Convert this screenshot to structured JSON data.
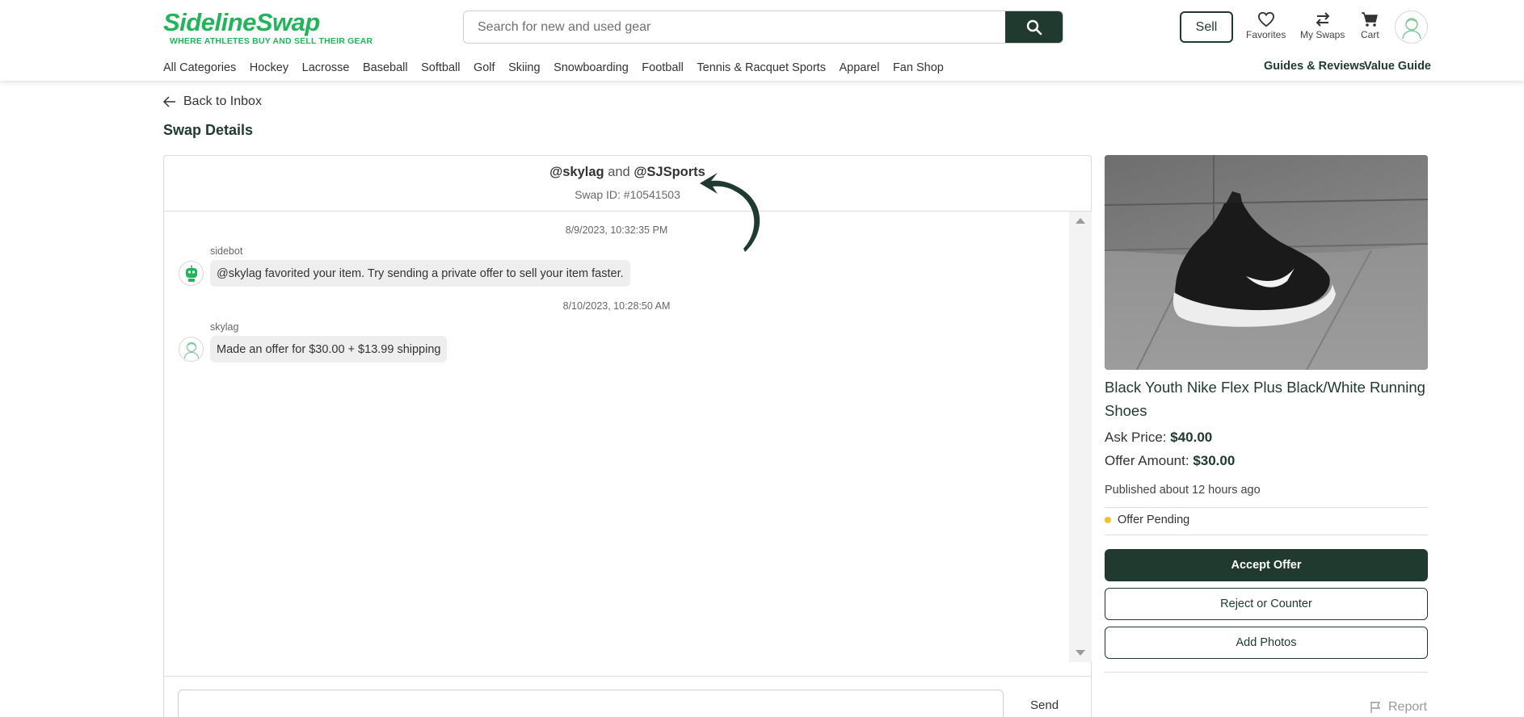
{
  "brand": {
    "logo_text": "SidelineSwap",
    "tagline": "WHERE ATHLETES BUY AND SELL THEIR GEAR",
    "accent": "#22b45a",
    "dark": "#213a30"
  },
  "header": {
    "search_placeholder": "Search for new and used gear",
    "sell_label": "Sell",
    "favorites_label": "Favorites",
    "swaps_label": "My Swaps",
    "cart_label": "Cart"
  },
  "nav": {
    "items": [
      "All Categories",
      "Hockey",
      "Lacrosse",
      "Baseball",
      "Softball",
      "Golf",
      "Skiing",
      "Snowboarding",
      "Football",
      "Tennis & Racquet Sports",
      "Apparel",
      "Fan Shop"
    ],
    "guides_label": "Guides & Reviews",
    "value_guide_label": "Value Guide"
  },
  "page": {
    "back_label": "Back to Inbox",
    "title": "Swap Details"
  },
  "chat": {
    "buyer": "@skylag",
    "and_text": "and",
    "seller": "@SJSports",
    "swap_id": "Swap ID: #10541503",
    "messages": [
      {
        "timestamp": "8/9/2023, 10:32:35 PM",
        "sender": "sidebot",
        "text": "@skylag favorited your item. Try sending a private offer to sell your item faster."
      },
      {
        "timestamp": "8/10/2023, 10:28:50 AM",
        "sender": "skylag",
        "text": "Made an offer for $30.00 + $13.99 shipping"
      }
    ],
    "send_label": "Send"
  },
  "product": {
    "title": "Black Youth Nike Flex Plus Black/White Running Shoes",
    "ask_label": "Ask Price:",
    "ask_value": "$40.00",
    "offer_label": "Offer Amount:",
    "offer_value": "$30.00",
    "published": "Published about 12 hours ago",
    "status": "Offer Pending",
    "status_color": "#f2c12e"
  },
  "actions": {
    "accept": "Accept Offer",
    "reject": "Reject or Counter",
    "add_photos": "Add Photos",
    "report": "Report"
  }
}
